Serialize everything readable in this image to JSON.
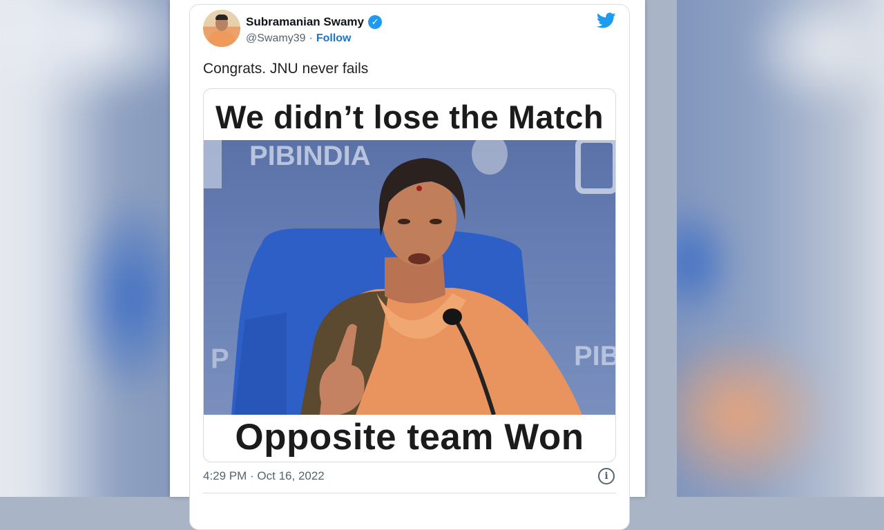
{
  "tweet": {
    "author_name": "Subramanian Swamy",
    "verified_mark": "✓",
    "handle": "@Swamy39",
    "separator": "·",
    "follow_label": "Follow",
    "text": "Congrats. JNU never fails",
    "media": {
      "caption_top": "We didn’t lose the Match",
      "caption_bottom": "Opposite team Won",
      "photo_backdrop_text": "PIBINDIA",
      "photo_backdrop_text_right": "PIB",
      "photo_backdrop_text_left": "P"
    },
    "timestamp": "4:29 PM · Oct 16, 2022",
    "info_glyph": "i"
  },
  "colors": {
    "twitter_blue": "#1d9bf0",
    "follow_blue": "#1d74c9",
    "muted_text": "#536471",
    "saree_orange": "#e9935f"
  },
  "icons": [
    "verified-badge-icon",
    "twitter-bird-icon",
    "info-icon"
  ]
}
